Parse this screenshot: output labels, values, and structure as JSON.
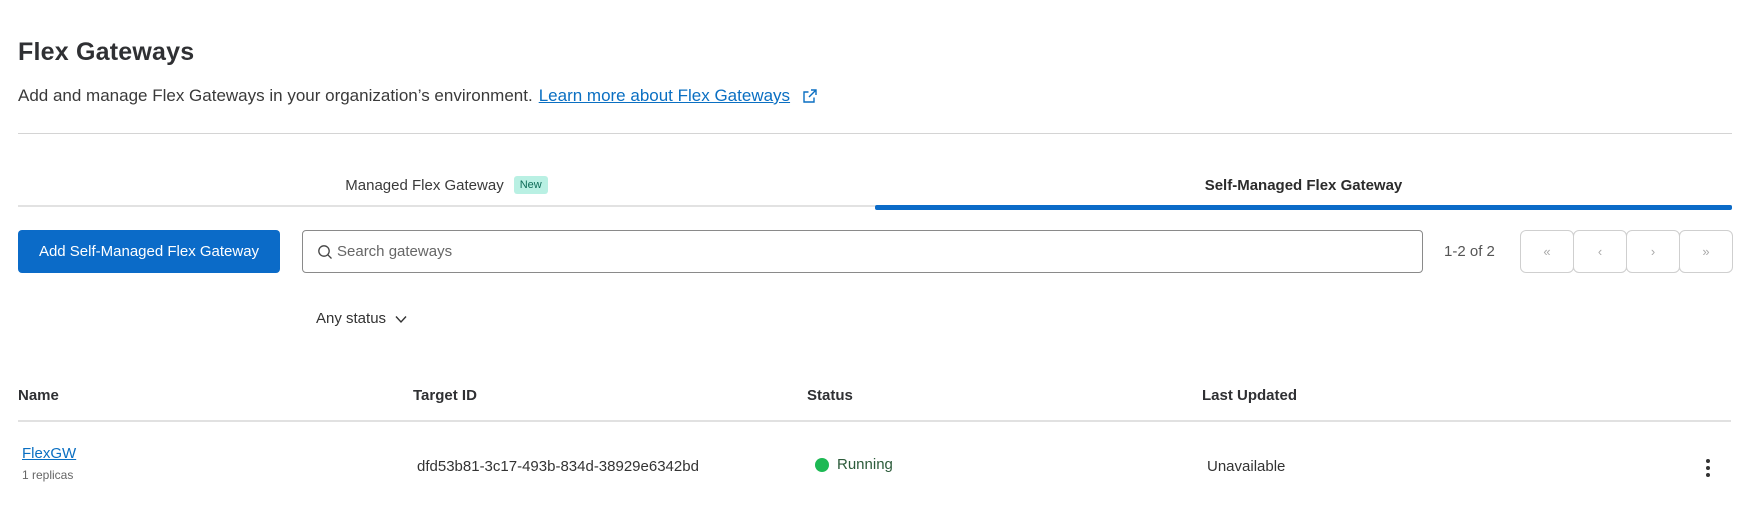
{
  "header": {
    "title": "Flex Gateways",
    "subtitle": "Add and manage Flex Gateways in your organization’s environment.",
    "learn_more_link": "Learn more about Flex Gateways"
  },
  "tabs": [
    {
      "label": "Managed Flex Gateway",
      "badge": "New",
      "selected": false
    },
    {
      "label": "Self-Managed Flex Gateway",
      "selected": true
    }
  ],
  "toolbar": {
    "add_button_label": "Add Self-Managed Flex Gateway",
    "search_placeholder": "Search gateways",
    "pagination_text": "1-2 of 2",
    "pager_first": "«",
    "pager_prev": "‹",
    "pager_next": "›",
    "pager_last": "»"
  },
  "filter": {
    "status_label": "Any status"
  },
  "table": {
    "columns": [
      "Name",
      "Target ID",
      "Status",
      "Last Updated"
    ],
    "rows": [
      {
        "name": "FlexGW",
        "replicas": "1 replicas",
        "target_id": "dfd53b81-3c17-493b-834d-38929e6342bd",
        "status": "Running",
        "last_updated": "Unavailable"
      }
    ]
  },
  "colors": {
    "accent": "#0b6bc8",
    "link": "#0a6fc2",
    "running": "#1db954",
    "badge_bg": "#b9f0e3"
  },
  "icons": [
    "external-link-icon",
    "search-icon",
    "chevron-down-icon",
    "kebab-menu-icon",
    "status-dot-icon"
  ]
}
